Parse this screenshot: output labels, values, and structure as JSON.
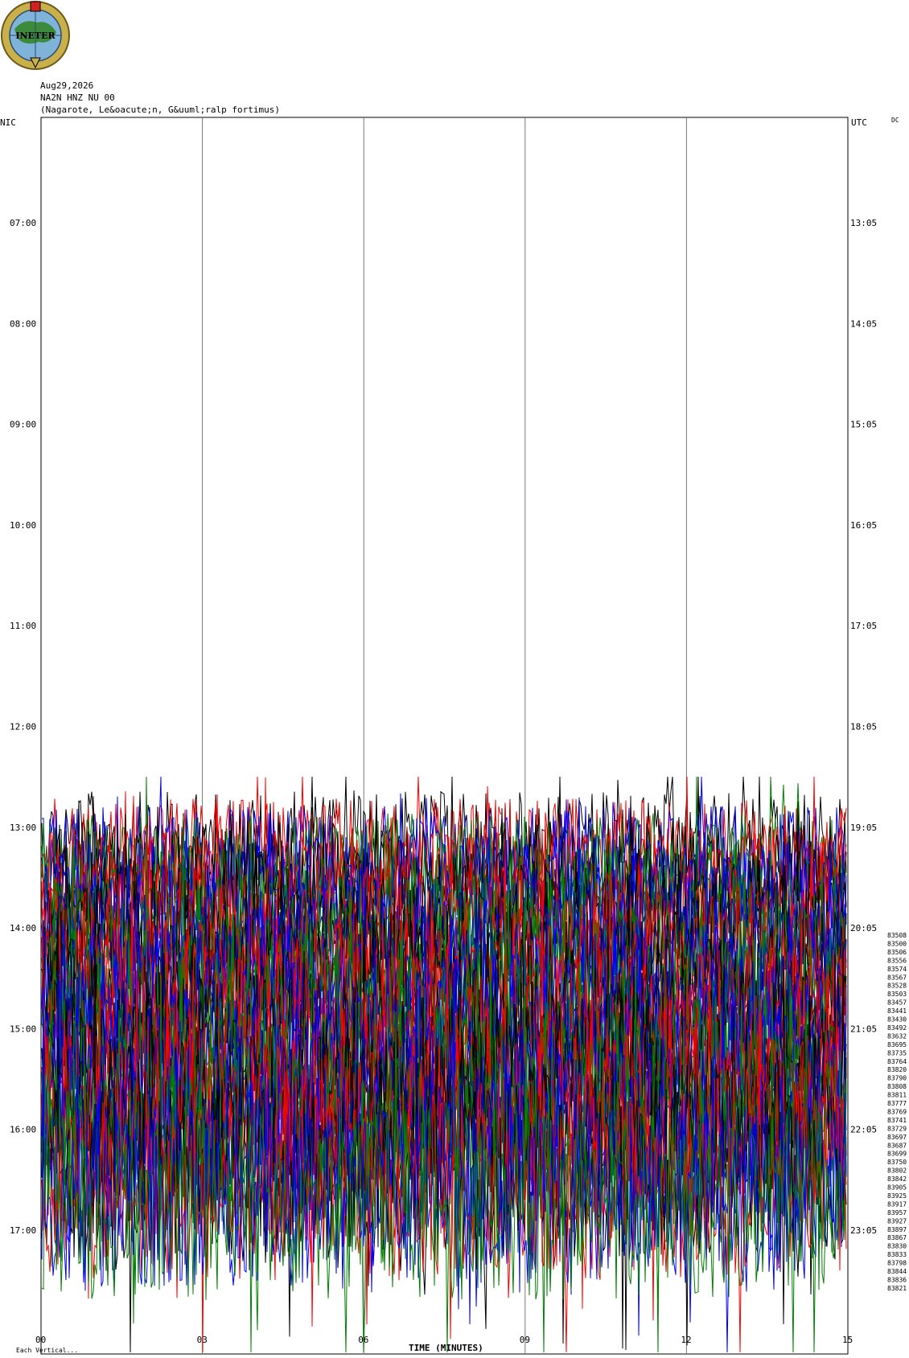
{
  "header": {
    "date": "Aug29,2026",
    "station": "NA2N HNZ NU 00",
    "location": "(Nagarote, Le&oacute;n, G&uuml;ralp fortimus)"
  },
  "logo": {
    "text": "INETER"
  },
  "axes": {
    "left_title": "NIC",
    "right_title": "UTC",
    "right_corner": "DC",
    "left_labels": [
      "07:00",
      "08:00",
      "09:00",
      "10:00",
      "11:00",
      "12:00",
      "13:00",
      "14:00",
      "15:00",
      "16:00",
      "17:00"
    ],
    "right_labels": [
      "13:05",
      "14:05",
      "15:05",
      "16:05",
      "17:05",
      "18:05",
      "19:05",
      "20:05",
      "21:05",
      "22:05",
      "23:05"
    ],
    "bottom_ticks": [
      "00",
      "03",
      "06",
      "09",
      "12",
      "15"
    ],
    "footer_left": "Each Vertical...",
    "footer_center": "TIME (MINUTES)"
  },
  "chart_data": {
    "type": "line",
    "title": "NA2N HNZ NU 00",
    "xlabel": "TIME (MINUTES)",
    "ylabel": "",
    "xlim": [
      0,
      15
    ],
    "colors": [
      "#000000",
      "#ff0000",
      "#0000ff",
      "#008000"
    ],
    "first_trace_hour_local": "13:20",
    "trace_count": 44,
    "dc_values": [
      83508,
      83500,
      83506,
      83556,
      83574,
      83567,
      83528,
      83503,
      83457,
      83441,
      83430,
      83492,
      83632,
      83695,
      83735,
      83764,
      83820,
      83790,
      83808,
      83811,
      83777,
      83769,
      83741,
      83729,
      83697,
      83687,
      83699,
      83750,
      83802,
      83842,
      83905,
      83925,
      83917,
      83957,
      83927,
      83897,
      83867,
      83830,
      83833,
      83798,
      83844,
      83836,
      83821
    ]
  }
}
